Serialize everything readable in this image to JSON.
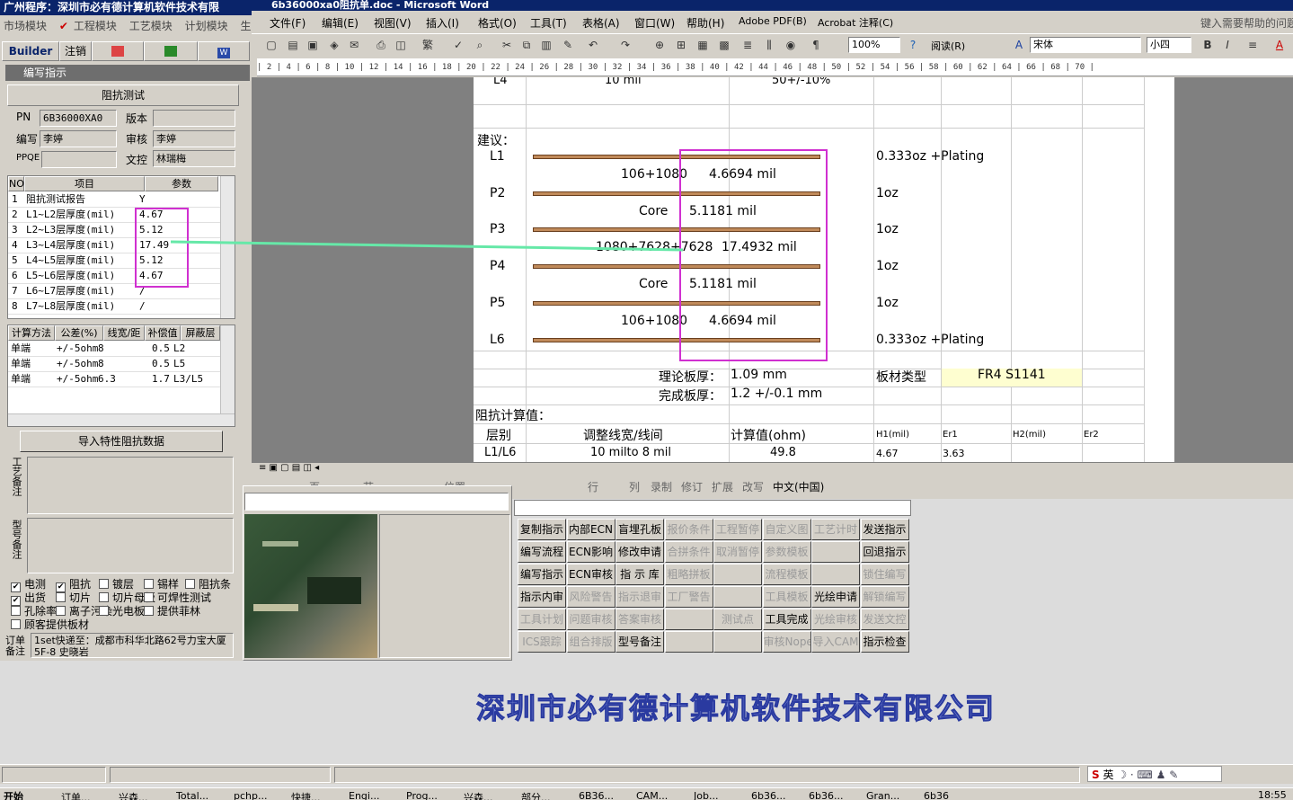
{
  "left_app": {
    "title": "广州程序：深圳市必有德计算机软件技术有限",
    "menu": [
      "市场模块",
      "工程模块",
      "工艺模块",
      "计划模块",
      "生"
    ],
    "tabs": [
      "Builder",
      "注销"
    ],
    "panel_title": "编写指示",
    "section_title": "阻抗测试",
    "pn_label": "PN",
    "pn_value": "6B36000XA0",
    "version_label": "版本",
    "version_value": "",
    "writer_label": "编写",
    "writer_value": "李婷",
    "reviewer_label": "审核",
    "reviewer_value": "李婷",
    "pfqe_label": "PPQE",
    "pfqe_value": "",
    "wenkong_label": "文控",
    "wenkong_value": "林瑞梅",
    "grid1_headers": [
      "NO",
      "项目",
      "参数"
    ],
    "grid1_rows": [
      {
        "no": "1",
        "item": "阻抗测试报告",
        "val": "Y"
      },
      {
        "no": "2",
        "item": "L1~L2层厚度(mil)",
        "val": "4.67"
      },
      {
        "no": "3",
        "item": "L2~L3层厚度(mil)",
        "val": "5.12"
      },
      {
        "no": "4",
        "item": "L3~L4层厚度(mil)",
        "val": "17.49"
      },
      {
        "no": "5",
        "item": "L4~L5层厚度(mil)",
        "val": "5.12"
      },
      {
        "no": "6",
        "item": "L5~L6层厚度(mil)",
        "val": "4.67"
      },
      {
        "no": "7",
        "item": "L6~L7层厚度(mil)",
        "val": "/"
      },
      {
        "no": "8",
        "item": "L7~L8层厚度(mil)",
        "val": "/"
      }
    ],
    "grid2_headers": [
      "计算方法",
      "公差(%)",
      "线宽/距",
      "补偿值",
      "屏蔽层"
    ],
    "grid2_rows": [
      {
        "a": "单端",
        "b": "+/-5ohm",
        "c": "8",
        "d": "0.5",
        "e": "L2"
      },
      {
        "a": "单端",
        "b": "+/-5ohm",
        "c": "8",
        "d": "0.5",
        "e": "L5"
      },
      {
        "a": "单端",
        "b": "+/-5ohm",
        "c": "6.3",
        "d": "1.7",
        "e": "L3/L5"
      }
    ],
    "import_button": "导入特性阻抗数据",
    "note1_label": "工艺备注",
    "note2_label": "型号备注",
    "checks_row1": [
      "电测",
      "阻抗",
      "镀层",
      "锡样",
      "阻抗条"
    ],
    "checks_row2": [
      "出货",
      "切片",
      "切片母板",
      "可焊性测试"
    ],
    "checks_row3": [
      "孔除率",
      "离子污染",
      "光电板",
      "提供菲林"
    ],
    "checks_row4": [
      "顾客提供板材"
    ],
    "order_label": "订单备注",
    "order_value": "1set快递至：成都市科华北路62号力宝大厦5F-8  史晓岩"
  },
  "word": {
    "title": "6b36000xa0阻抗单.doc - Microsoft Word",
    "menu": [
      "文件(F)",
      "编辑(E)",
      "视图(V)",
      "插入(I)",
      "格式(O)",
      "工具(T)",
      "表格(A)",
      "窗口(W)",
      "帮助(H)",
      "Adobe PDF(B)",
      "Acrobat 注释(C)"
    ],
    "help_box": "键入需要帮助的问题",
    "zoom": "100%",
    "reading": "阅读(R)",
    "font": "宋体",
    "size": "小四",
    "ruler": "| 2 | 4 | 6 | 8 | 10 | 12 | 14 | 16 | 18 | 20 | 22 | 24 | 26 | 28 | 30 | 32 | 34 | 36 | 38 | 40 | 42 | 44 | 46 | 48 | 50 | 52 | 54 | 56 | 58 | 60 | 62 | 64 | 66 | 68 | 70 |",
    "doc": {
      "top_l4": "L4",
      "top_mil": "10 mil",
      "top_tol": "50+/-10%",
      "suggest": "建议：",
      "layers": [
        "L1",
        "P2",
        "P3",
        "P4",
        "P5",
        "L6"
      ],
      "dielectrics": [
        {
          "name": "106+1080",
          "thick": "4.6694 mil"
        },
        {
          "name": "Core",
          "thick": "5.1181 mil"
        },
        {
          "name": "1080+7628+7628",
          "thick": "17.4932 mil"
        },
        {
          "name": "Core",
          "thick": "5.1181 mil"
        },
        {
          "name": "106+1080",
          "thick": "4.6694 mil"
        }
      ],
      "copper": [
        "0.333oz +Plating",
        "1oz",
        "1oz",
        "1oz",
        "1oz",
        "0.333oz +Plating"
      ],
      "theory_label": "理论板厚：",
      "theory_value": "1.09 mm",
      "finish_label": "完成板厚：",
      "finish_value": "1.2 +/-0.1 mm",
      "board_type_label": "板材类型",
      "board_type_value": "FR4 S1141",
      "impedance_calc": "阻抗计算值：",
      "hdr_layer": "层别",
      "hdr_adjust": "调整线宽/线间",
      "hdr_calc": "计算值(ohm)",
      "hdr_h1": "H1(mil)",
      "hdr_er1": "Er1",
      "hdr_h2": "H2(mil)",
      "hdr_er2": "Er2",
      "row_layer": "L1/L6",
      "row_adjust": "10 milto 8 mil",
      "row_calc": "49.8",
      "row_h1": "4.67",
      "row_er1": "3.63"
    },
    "status": [
      "页",
      "节",
      "位置",
      "行",
      "列",
      "录制",
      "修订",
      "扩展",
      "改写",
      "中文(中国)"
    ]
  },
  "buttons": [
    [
      "复制指示",
      "内部ECN",
      "盲埋孔板",
      "报价条件",
      "工程暂停",
      "自定义图",
      "工艺计时",
      "发送指示"
    ],
    [
      "编写流程",
      "ECN影响",
      "修改申请",
      "合拼条件",
      "取消暂停",
      "参数模板",
      "",
      "回退指示"
    ],
    [
      "编写指示",
      "ECN审核",
      "指 示 库",
      "粗略拼板",
      "",
      "流程模板",
      "",
      "锁住编写"
    ],
    [
      "指示内审",
      "风险警告",
      "指示退审",
      "工厂警告",
      "",
      "工具模板",
      "光绘申请",
      "解锁编写"
    ],
    [
      "工具计划",
      "问题审核",
      "答案审核",
      "",
      "测试点",
      "工具完成",
      "光绘审核",
      "发送文控"
    ],
    [
      "ICS跟踪",
      "组合排版",
      "型号备注",
      "",
      "",
      "审核Nope",
      "导入CAM",
      "指示检查"
    ]
  ],
  "buttons_disabled": [
    [
      false,
      false,
      false,
      true,
      true,
      true,
      true,
      false
    ],
    [
      false,
      false,
      false,
      true,
      true,
      true,
      true,
      false
    ],
    [
      false,
      false,
      false,
      true,
      true,
      true,
      true,
      true
    ],
    [
      false,
      true,
      true,
      true,
      true,
      true,
      false,
      true
    ],
    [
      true,
      true,
      true,
      true,
      true,
      false,
      true,
      true
    ],
    [
      true,
      true,
      false,
      true,
      true,
      true,
      true,
      false
    ]
  ],
  "company_banner": "深圳市必有德计算机软件技术有限公司",
  "taskbar": {
    "start": "开始",
    "items": [
      "订单...",
      "兴森...",
      "Total...",
      "pchp...",
      "快捷...",
      "Engi...",
      "Prog...",
      "兴森...",
      "部分...",
      "6B36...",
      "CAM...",
      "Job...",
      "6b36...",
      "6b36...",
      "Gran...",
      "6b36"
    ],
    "time": "18:55",
    "ime": "英"
  }
}
